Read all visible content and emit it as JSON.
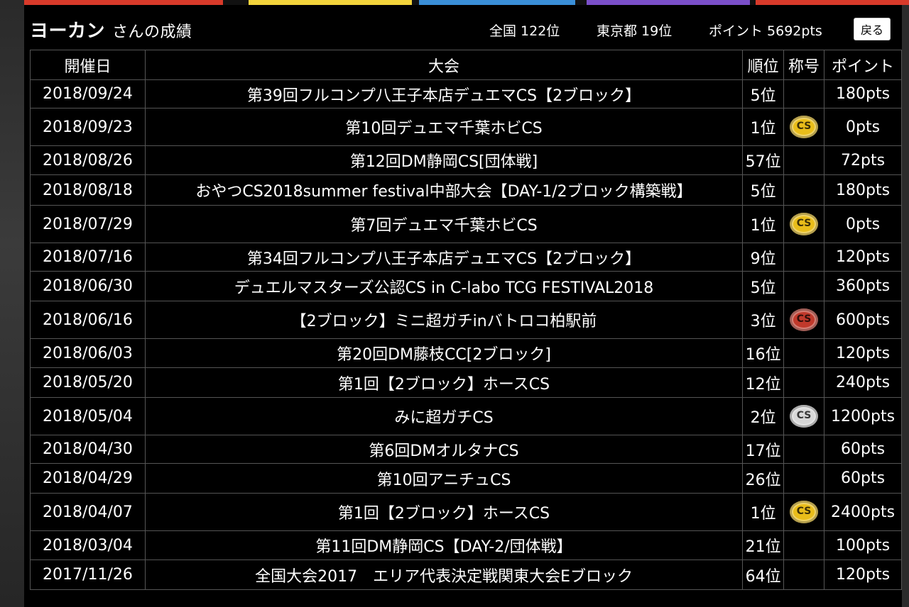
{
  "header": {
    "name": "ヨーカン",
    "suffix": "さんの成績",
    "national": "全国 122位",
    "tokyo": "東京都 19位",
    "points": "ポイント 5692pts",
    "back_label": "戻る"
  },
  "table": {
    "headers": [
      "開催日",
      "大会",
      "順位",
      "称号",
      "ポイント"
    ],
    "rows": [
      {
        "date": "2018/09/24",
        "event": "第39回フルコンプ八王子本店デュエマCS【2ブロック】",
        "rank": "5位",
        "medal": "",
        "points": "180pts"
      },
      {
        "date": "2018/09/23",
        "event": "第10回デュエマ千葉ホビCS",
        "rank": "1位",
        "medal": "gold",
        "points": "0pts"
      },
      {
        "date": "2018/08/26",
        "event": "第12回DM静岡CS[団体戦]",
        "rank": "57位",
        "medal": "",
        "points": "72pts"
      },
      {
        "date": "2018/08/18",
        "event": "おやつCS2018summer festival中部大会【DAY-1/2ブロック構築戦】",
        "rank": "5位",
        "medal": "",
        "points": "180pts"
      },
      {
        "date": "2018/07/29",
        "event": "第7回デュエマ千葉ホビCS",
        "rank": "1位",
        "medal": "gold",
        "points": "0pts"
      },
      {
        "date": "2018/07/16",
        "event": "第34回フルコンプ八王子本店デュエマCS【2ブロック】",
        "rank": "9位",
        "medal": "",
        "points": "120pts"
      },
      {
        "date": "2018/06/30",
        "event": "デュエルマスターズ公認CS in C-labo TCG FESTIVAL2018",
        "rank": "5位",
        "medal": "",
        "points": "360pts"
      },
      {
        "date": "2018/06/16",
        "event": "【2ブロック】ミニ超ガチinバトロコ柏駅前",
        "rank": "3位",
        "medal": "bronze",
        "points": "600pts"
      },
      {
        "date": "2018/06/03",
        "event": "第20回DM藤枝CC[2ブロック]",
        "rank": "16位",
        "medal": "",
        "points": "120pts"
      },
      {
        "date": "2018/05/20",
        "event": "第1回【2ブロック】ホースCS",
        "rank": "12位",
        "medal": "",
        "points": "240pts"
      },
      {
        "date": "2018/05/04",
        "event": "みに超ガチCS",
        "rank": "2位",
        "medal": "silver",
        "points": "1200pts"
      },
      {
        "date": "2018/04/30",
        "event": "第6回DMオルタナCS",
        "rank": "17位",
        "medal": "",
        "points": "60pts"
      },
      {
        "date": "2018/04/29",
        "event": "第10回アニチュCS",
        "rank": "26位",
        "medal": "",
        "points": "60pts"
      },
      {
        "date": "2018/04/07",
        "event": "第1回【2ブロック】ホースCS",
        "rank": "1位",
        "medal": "gold",
        "points": "2400pts"
      },
      {
        "date": "2018/03/04",
        "event": "第11回DM静岡CS【DAY-2/団体戦】",
        "rank": "21位",
        "medal": "",
        "points": "100pts"
      },
      {
        "date": "2017/11/26",
        "event": "全国大会2017　エリア代表決定戦関東大会Eブロック",
        "rank": "64位",
        "medal": "",
        "points": "120pts"
      }
    ]
  },
  "medal_text": "CS",
  "colors": {
    "tab_1": "#d83a2a",
    "tab_2": "#f3d43c",
    "tab_3": "#3a8fd8",
    "tab_4": "#7a4fc9",
    "tab_5": "#d83a2a",
    "gold": "#e9bd1a",
    "silver": "#d8d8d8",
    "bronze": "#c0392b"
  }
}
